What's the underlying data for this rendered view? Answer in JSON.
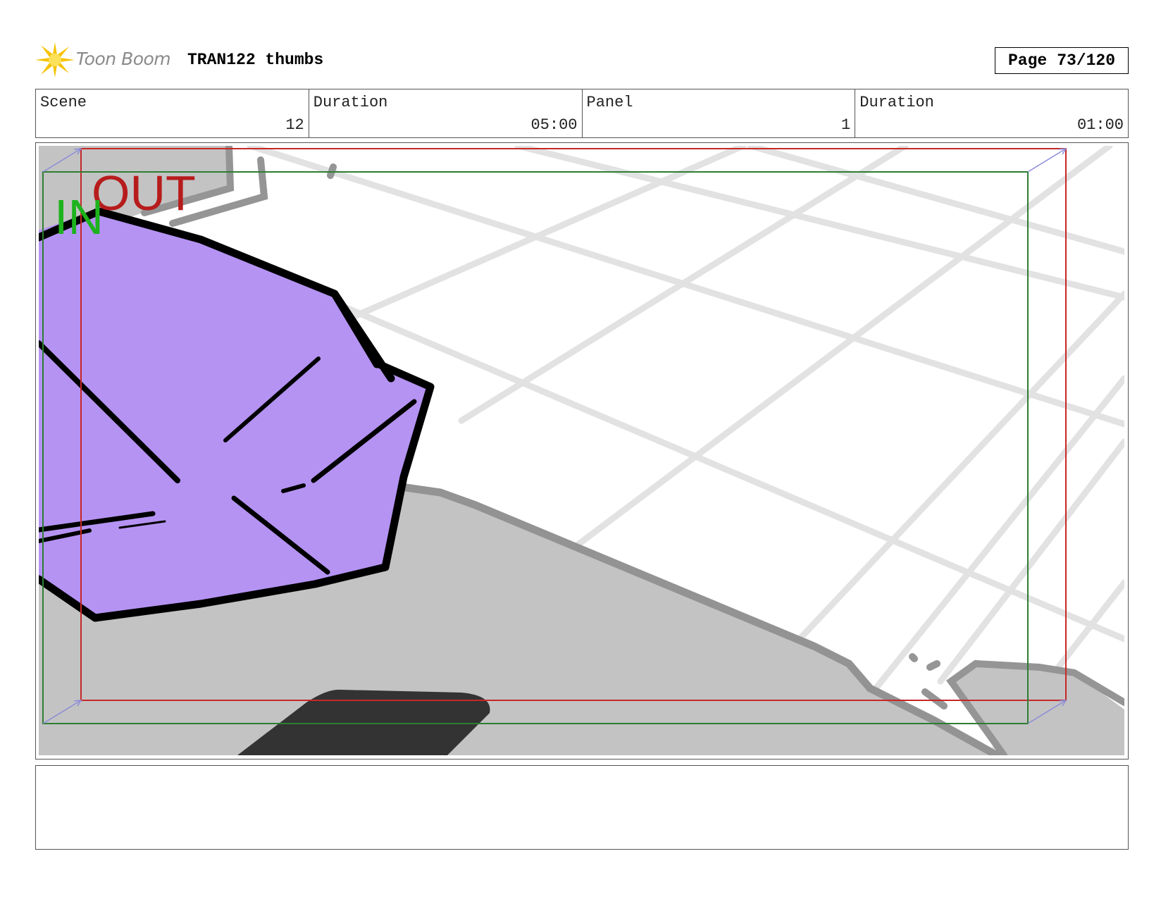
{
  "header": {
    "logo_text": "Toon Boom",
    "title": "TRAN122 thumbs",
    "page_label": "Page",
    "page_value": "73/120"
  },
  "info": {
    "scene_label": "Scene",
    "scene_value": "12",
    "scene_duration_label": "Duration",
    "scene_duration_value": "05:00",
    "panel_label": "Panel",
    "panel_value": "1",
    "panel_duration_label": "Duration",
    "panel_duration_value": "01:00"
  },
  "panel": {
    "in_label": "IN",
    "out_label": "OUT",
    "colors": {
      "in_frame": "#2e7d32",
      "out_frame": "#c62828",
      "purple_shape": "#b593f3",
      "floor_shadow": "#c3c3c3",
      "grid_lines": "#e2e2e2",
      "dark_shadow": "#333333"
    }
  },
  "notes": {
    "text": ""
  }
}
